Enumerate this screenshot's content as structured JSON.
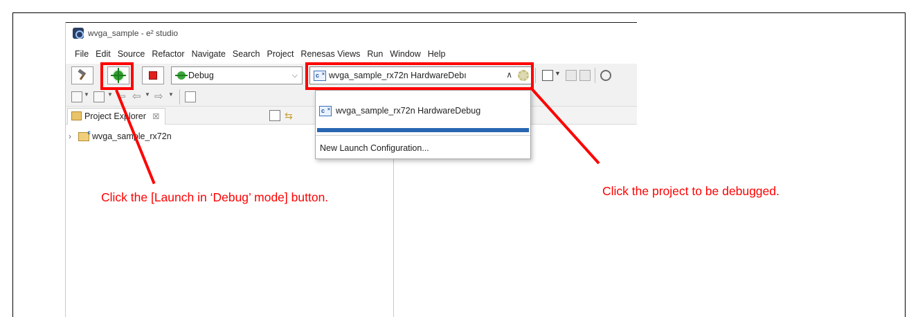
{
  "window": {
    "title": "wvga_sample - e² studio"
  },
  "menu": [
    "File",
    "Edit",
    "Source",
    "Refactor",
    "Navigate",
    "Search",
    "Project",
    "Renesas Views",
    "Run",
    "Window",
    "Help"
  ],
  "toolbar": {
    "launch_mode": "Debug",
    "launch_config": "wvga_sample_rx72n HardwareDebı"
  },
  "explorer": {
    "tab_label": "Project Explorer",
    "tab_close": "☒",
    "tree": [
      {
        "label": "wvga_sample_rx72n",
        "expanded": false
      }
    ]
  },
  "launch_dropdown": {
    "items": [
      {
        "label": "wvga_sample_rx72n HardwareDebug"
      },
      {
        "label": "New Launch Configuration..."
      }
    ]
  },
  "annotations": {
    "debug_button_hint": "Click the [Launch in ‘Debug’ mode] button.",
    "project_hint": "Click the project to be debugged.",
    "color": "#ff0000"
  },
  "icons": [
    "app-icon",
    "hammer-icon",
    "bug-icon",
    "stop-icon",
    "c-file-icon",
    "gear-icon",
    "folder-icon",
    "explorer-icon"
  ]
}
